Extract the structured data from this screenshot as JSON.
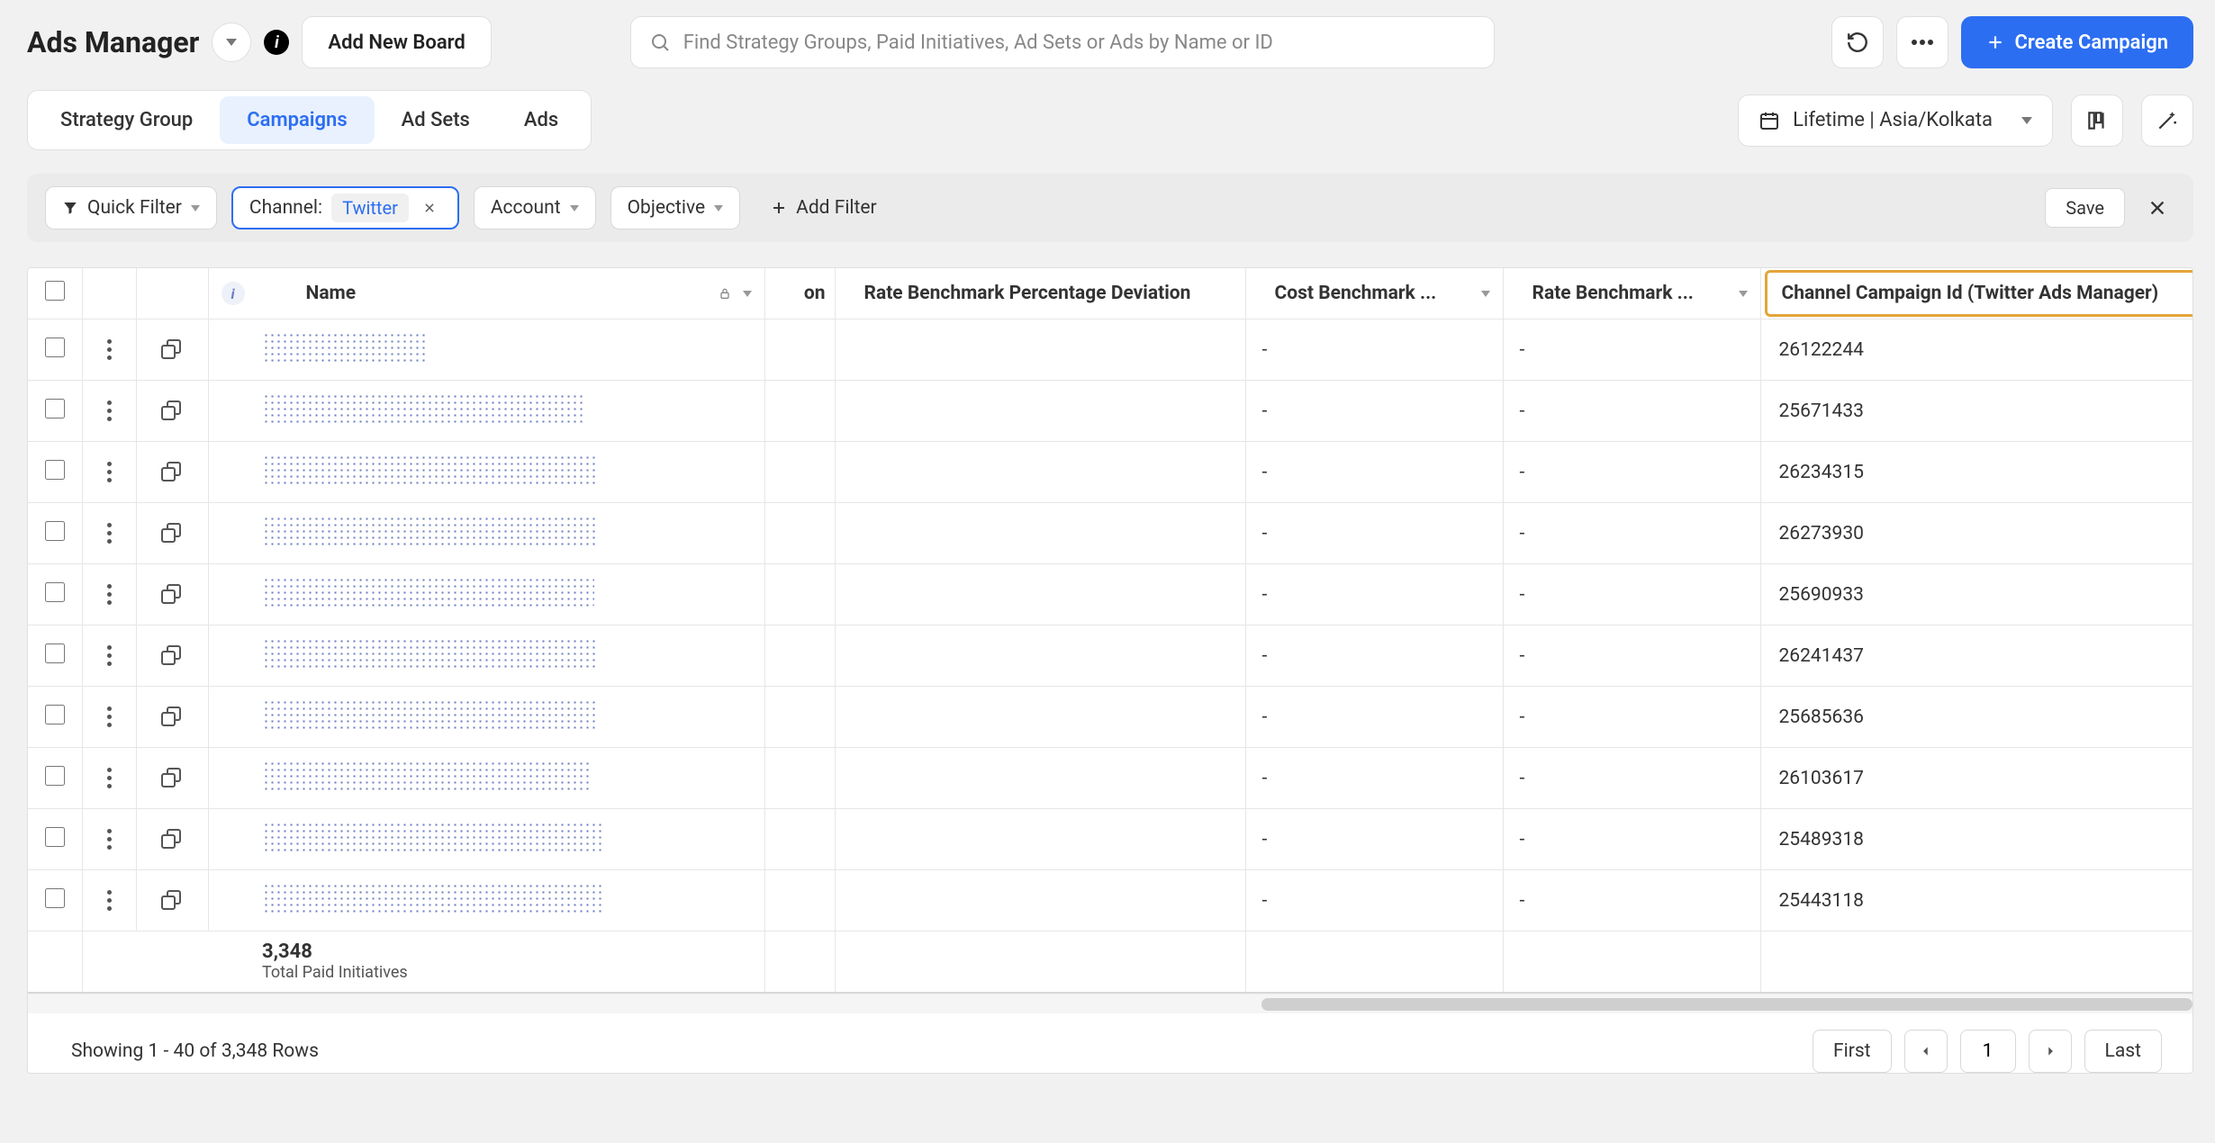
{
  "header": {
    "title": "Ads Manager",
    "add_board": "Add New Board",
    "search_placeholder": "Find Strategy Groups, Paid Initiatives, Ad Sets or Ads by Name or ID",
    "create_campaign": "Create Campaign"
  },
  "tabs": {
    "items": [
      "Strategy Group",
      "Campaigns",
      "Ad Sets",
      "Ads"
    ],
    "active_index": 1,
    "daterange": "Lifetime | Asia/Kolkata"
  },
  "filters": {
    "quick_filter": "Quick Filter",
    "channel_label": "Channel:",
    "channel_value": "Twitter",
    "account": "Account",
    "objective": "Objective",
    "add_filter": "Add Filter",
    "save": "Save"
  },
  "table": {
    "columns": {
      "name": "Name",
      "on_suffix": "on",
      "rate_dev": "Rate Benchmark Percentage Deviation",
      "cost": "Cost Benchmark ...",
      "rate2": "Rate Benchmark ...",
      "id": "Channel Campaign Id (Twitter Ads Manager)"
    },
    "rows": [
      {
        "name_w": 182,
        "cost": "-",
        "rate2": "-",
        "id": "26122244"
      },
      {
        "name_w": 358,
        "cost": "-",
        "rate2": "-",
        "id": "25671433"
      },
      {
        "name_w": 372,
        "cost": "-",
        "rate2": "-",
        "id": "26234315"
      },
      {
        "name_w": 370,
        "cost": "-",
        "rate2": "-",
        "id": "26273930"
      },
      {
        "name_w": 368,
        "cost": "-",
        "rate2": "-",
        "id": "25690933"
      },
      {
        "name_w": 370,
        "cost": "-",
        "rate2": "-",
        "id": "26241437"
      },
      {
        "name_w": 372,
        "cost": "-",
        "rate2": "-",
        "id": "25685636"
      },
      {
        "name_w": 362,
        "cost": "-",
        "rate2": "-",
        "id": "26103617"
      },
      {
        "name_w": 380,
        "cost": "-",
        "rate2": "-",
        "id": "25489318"
      },
      {
        "name_w": 378,
        "cost": "-",
        "rate2": "-",
        "id": "25443118"
      }
    ],
    "summary": {
      "count": "3,348",
      "label": "Total Paid Initiatives"
    }
  },
  "footer": {
    "showing": "Showing 1 - 40 of 3,348 Rows",
    "first": "First",
    "page": "1",
    "last": "Last"
  }
}
